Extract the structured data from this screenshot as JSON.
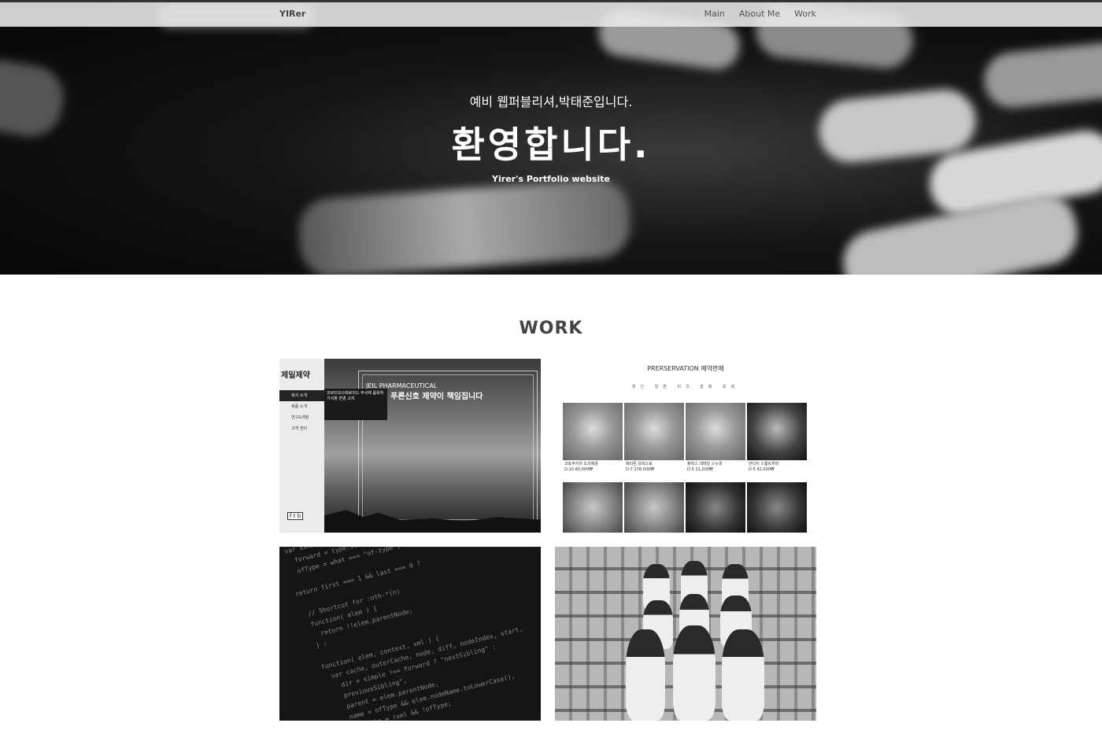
{
  "nav": {
    "brand": "YIRer",
    "links": [
      "Main",
      "About Me",
      "Work"
    ]
  },
  "hero": {
    "subtitle": "예비 웹퍼블리셔,박태준입니다.",
    "title": "환영합니다.",
    "tagline": "Yirer's Portfolio website"
  },
  "work": {
    "title": "WORK",
    "cards": [
      {
        "logo": "제일제약",
        "menu": [
          "회사 소개",
          "제품 소개",
          "연구&개발",
          "고객 센터"
        ],
        "notice": "코르티코스테로이드 주사제 품목허가사항 변경 고지",
        "brand_line": "JEIL PHARMACEUTICAL",
        "headline": "건강의 푸른신호 제약이 책임집니다",
        "social": "f t b"
      },
      {
        "title": "PRERSERVATION 예약판매",
        "tabs": "최신 일본 미국 발매 중화",
        "items": [
          {
            "desc": "코토부키야 도라에몽",
            "d": "D-10",
            "price": "60,000₩"
          },
          {
            "desc": "메타톤 프레스토",
            "d": "D-7",
            "price": "178,000₩"
          },
          {
            "desc": "플럭스 대테일 스누피",
            "d": "D-5",
            "price": "11,000₩"
          },
          {
            "desc": "반다이 스톰트루퍼",
            "d": "D-5",
            "price": "42,000₩"
          }
        ]
      },
      {
        "code": "var simple = type.slice(\n  forward = type.slice(\n  ofType = what === \"of-type\";\n\nreturn first === 1 && last === 0 ?\n\n  // Shortcut for :nth-*(n)\n  function( elem ) {\n    return !!elem.parentNode;\n  } :\n\n  function( elem, context, xml ) {\n    var cache, outerCache, node, diff, nodeIndex, start,\n      dir = simple !== forward ? \"nextSibling\" :\n      previousSibling\",\n      parent = elem.parentNode,\n      name = ofType && elem.nodeName.toLowerCase(),\n      useCache = !xml && !ofType;\n\n  if ( parent ) {"
      },
      {}
    ]
  }
}
